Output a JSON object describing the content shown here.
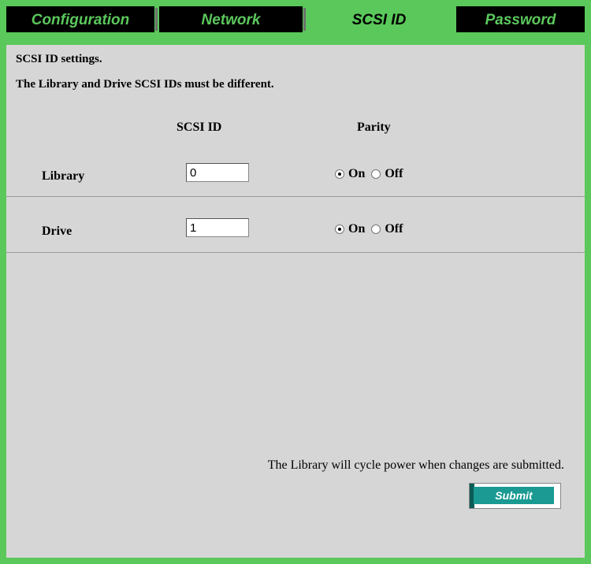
{
  "tabs": [
    {
      "label": "Configuration",
      "active": false
    },
    {
      "label": "Network",
      "active": false
    },
    {
      "label": "SCSI ID",
      "active": true
    },
    {
      "label": "Password",
      "active": false
    }
  ],
  "page": {
    "heading": "SCSI ID settings.",
    "subheading": "The Library and Drive SCSI IDs must be different."
  },
  "table": {
    "col_scsi_id": "SCSI ID",
    "col_parity": "Parity",
    "rows": [
      {
        "label": "Library",
        "scsi_id": "0",
        "parity": "On"
      },
      {
        "label": "Drive",
        "scsi_id": "1",
        "parity": "On"
      }
    ],
    "parity_options": [
      "On",
      "Off"
    ]
  },
  "footer": {
    "notice": "The Library will cycle power when changes are submitted.",
    "submit_label": "Submit"
  },
  "colors": {
    "frame_green": "#5ac85a",
    "panel_gray": "#d6d6d6",
    "tab_black": "#000000",
    "submit_teal": "#1a9a92"
  }
}
